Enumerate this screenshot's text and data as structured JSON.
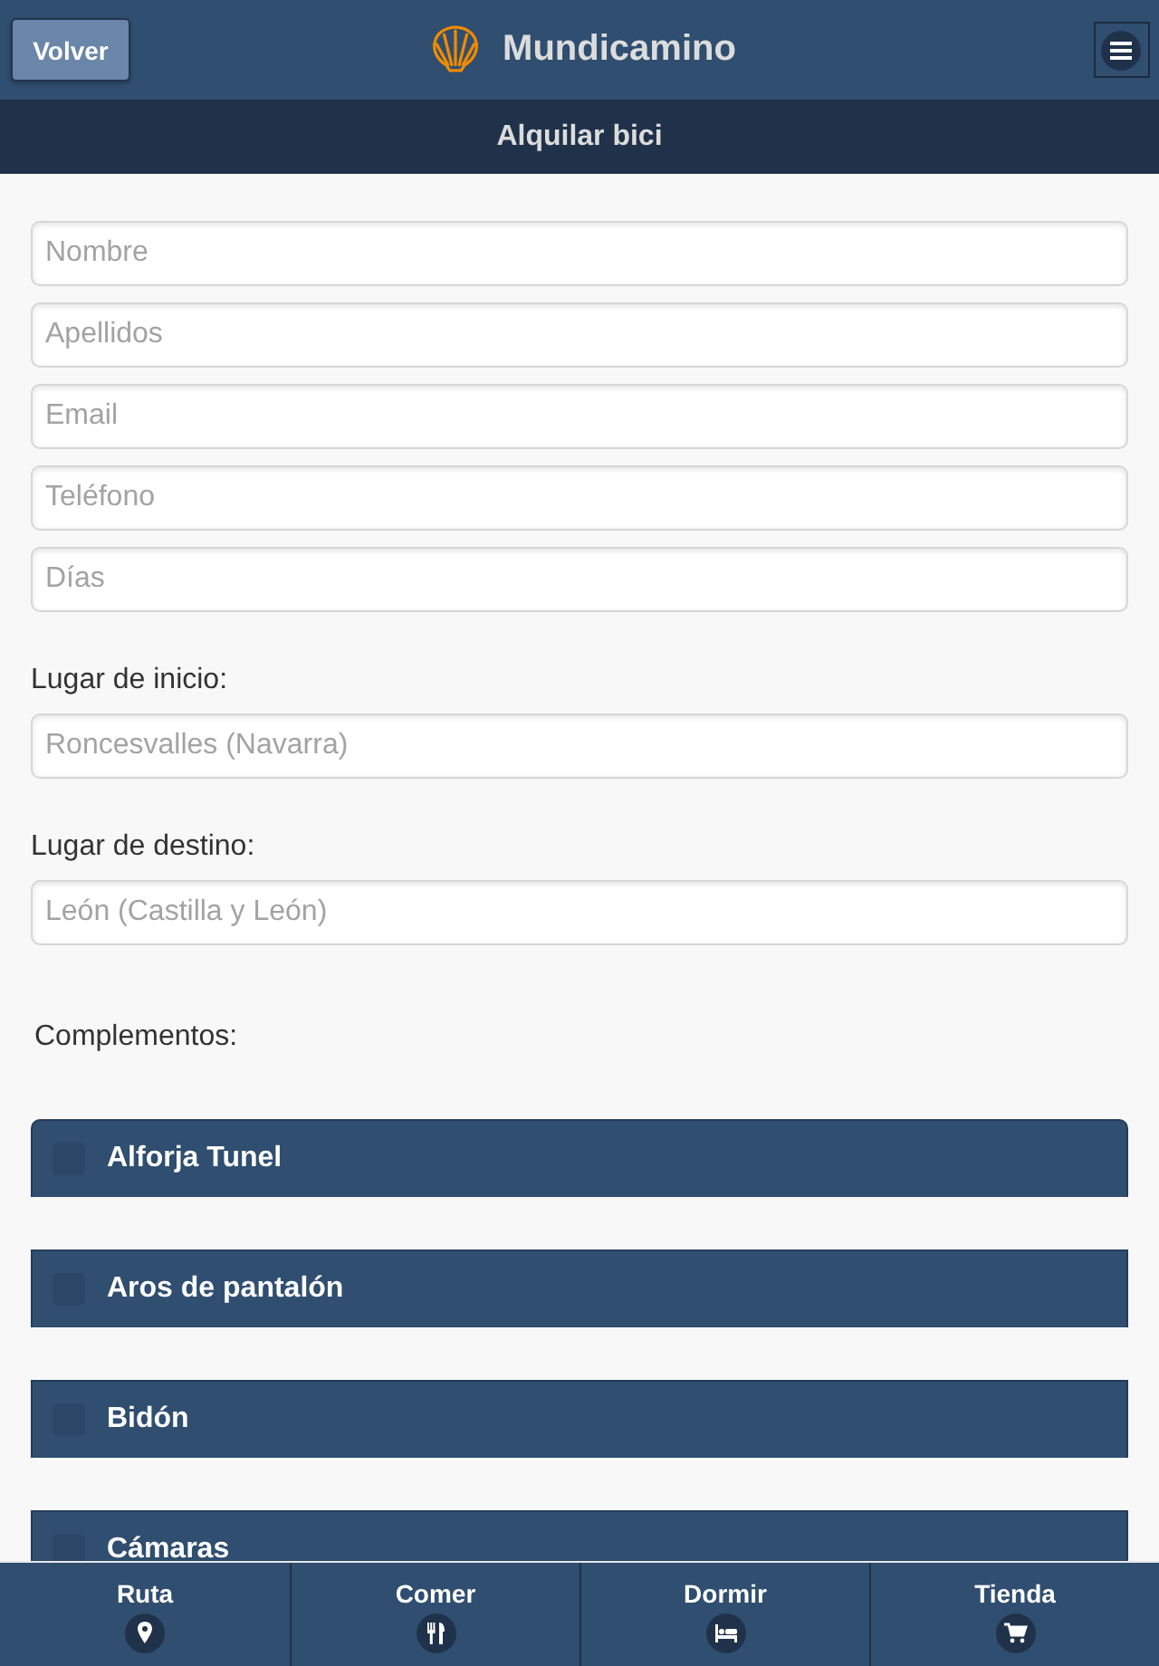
{
  "header": {
    "back_button": "Volver",
    "title": "Mundicamino"
  },
  "subheader": {
    "title": "Alquilar bici"
  },
  "form": {
    "fields": [
      {
        "placeholder": "Nombre"
      },
      {
        "placeholder": "Apellidos"
      },
      {
        "placeholder": "Email"
      },
      {
        "placeholder": "Teléfono"
      },
      {
        "placeholder": "Días"
      }
    ],
    "start": {
      "label": "Lugar de inicio:",
      "placeholder": "Roncesvalles (Navarra)"
    },
    "destination": {
      "label": "Lugar de destino:",
      "placeholder": "León (Castilla y León)"
    },
    "extras": {
      "label": "Complementos:",
      "items": [
        {
          "label": "Alforja Tunel",
          "checked": false
        },
        {
          "label": "Aros de pantalón",
          "checked": false
        },
        {
          "label": "Bidón",
          "checked": false
        },
        {
          "label": "Cámaras",
          "checked": false
        }
      ]
    }
  },
  "bottom_nav": [
    {
      "label": "Ruta"
    },
    {
      "label": "Comer"
    },
    {
      "label": "Dormir"
    },
    {
      "label": "Tienda"
    }
  ]
}
